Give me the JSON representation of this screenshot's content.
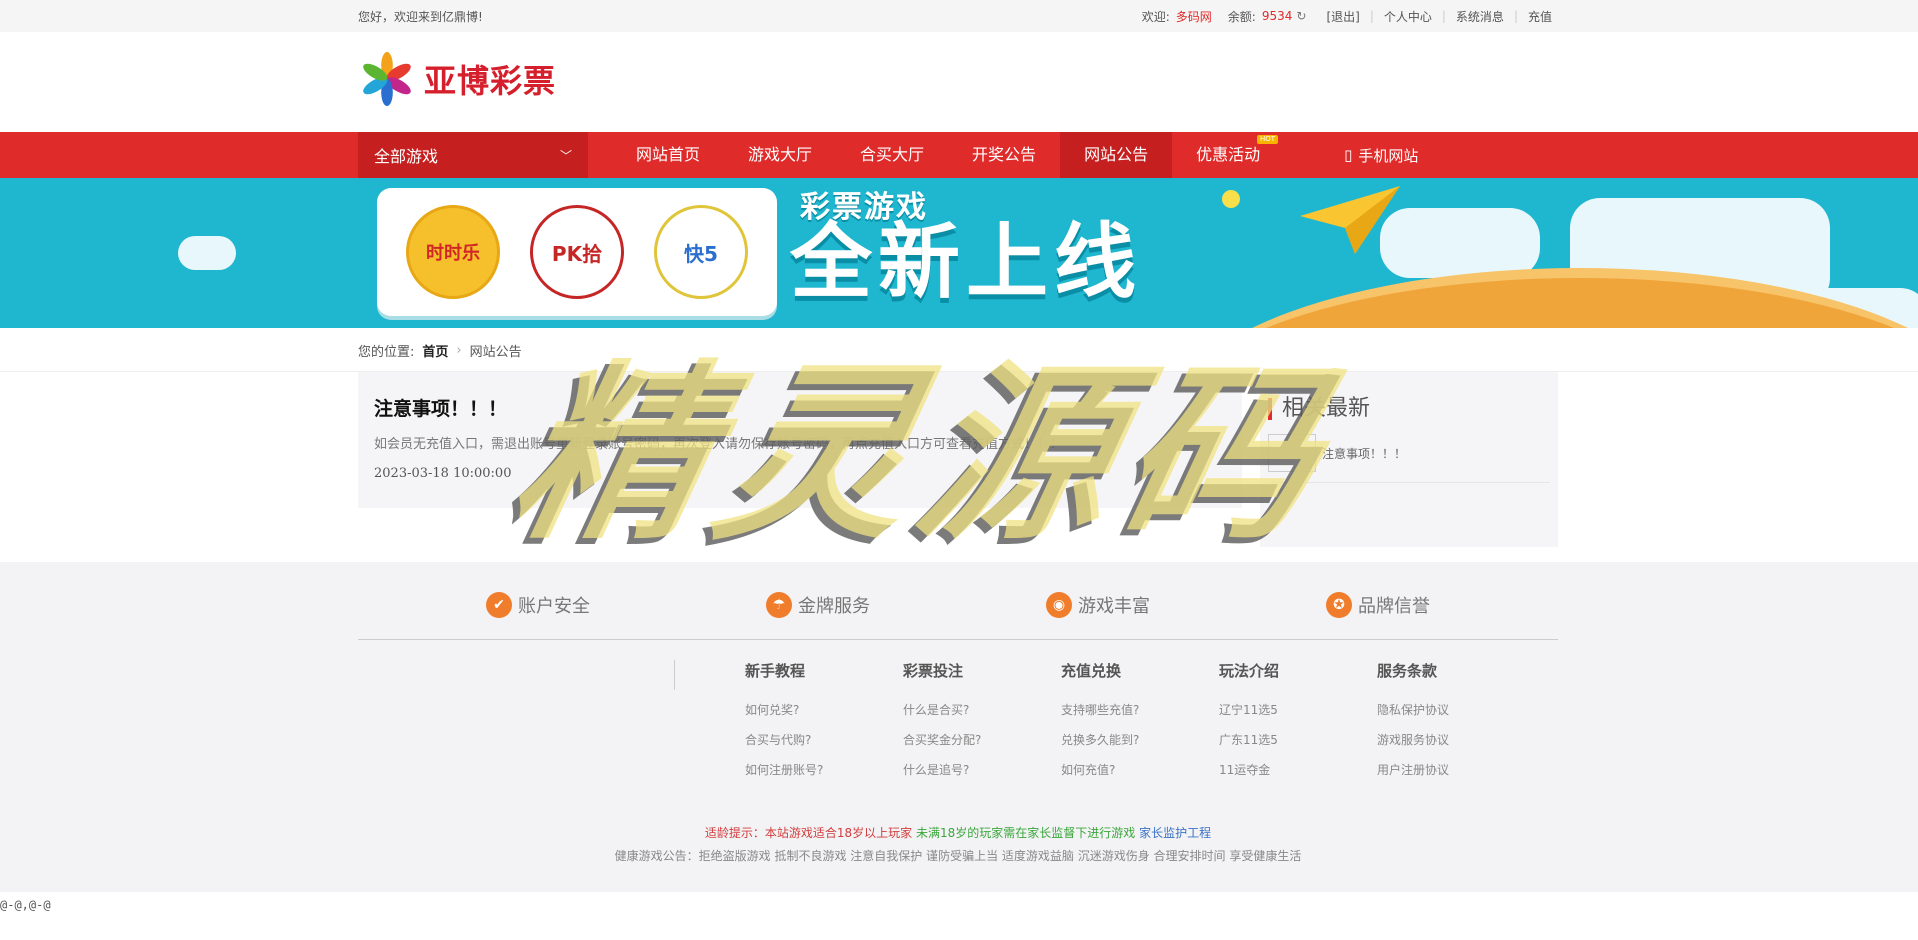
{
  "topbar": {
    "greeting": "您好，欢迎来到亿鼎博!",
    "welcome_label": "欢迎:",
    "username": "多码网",
    "balance_label": "余额:",
    "balance": "9534",
    "logout": "[退出]",
    "personal_center": "个人中心",
    "messages": "系统消息",
    "recharge": "充值"
  },
  "header": {
    "logo_text": "亚博彩票"
  },
  "nav": {
    "all_games": "全部游戏",
    "items": [
      "网站首页",
      "游戏大厅",
      "合买大厅",
      "开奖公告",
      "网站公告",
      "优惠活动"
    ],
    "hot_badge": "HOT",
    "mobile": "手机网站"
  },
  "banner": {
    "tag": "彩票游戏",
    "headline": "全新上线",
    "lotteries": [
      "时时乐",
      "PK拾",
      "快5"
    ]
  },
  "breadcrumb": {
    "label": "您的位置:",
    "home": "首页",
    "current": "网站公告"
  },
  "notice": {
    "title": "注意事项！！！",
    "body": "如会员无充值入口，需退出账号重新登录账号密码，再次登入请勿保存账号密码，再点充值入口方可查看充值方式！！！",
    "date": "2023-03-18 10:00:00"
  },
  "sidebar": {
    "title": "相关最新",
    "latest_item": "注意事项！！！"
  },
  "features": [
    "账户安全",
    "金牌服务",
    "游戏丰富",
    "品牌信誉"
  ],
  "footer_cols": [
    {
      "title": "新手教程",
      "links": [
        "如何兑奖?",
        "合买与代购?",
        "如何注册账号?"
      ]
    },
    {
      "title": "彩票投注",
      "links": [
        "什么是合买?",
        "合买奖金分配?",
        "什么是追号?"
      ]
    },
    {
      "title": "充值兑换",
      "links": [
        "支持哪些充值?",
        "兑换多久能到?",
        "如何充值?"
      ]
    },
    {
      "title": "玩法介绍",
      "links": [
        "辽宁11选5",
        "广东11选5",
        "11运夺金"
      ]
    },
    {
      "title": "服务条款",
      "links": [
        "隐私保护协议",
        "游戏服务协议",
        "用户注册协议"
      ]
    }
  ],
  "tips": {
    "age": "适龄提示：本站游戏适合18岁以上玩家",
    "minor": "未满18岁的玩家需在家长监督下进行游戏",
    "parent": "家长监护工程",
    "health": "健康游戏公告：拒绝盗版游戏 抵制不良游戏 注意自我保护 谨防受骗上当 适度游戏益脑 沉迷游戏伤身 合理安排时间 享受健康生活"
  },
  "bottom_text": "@-@,@-@",
  "watermark": "精灵源码"
}
